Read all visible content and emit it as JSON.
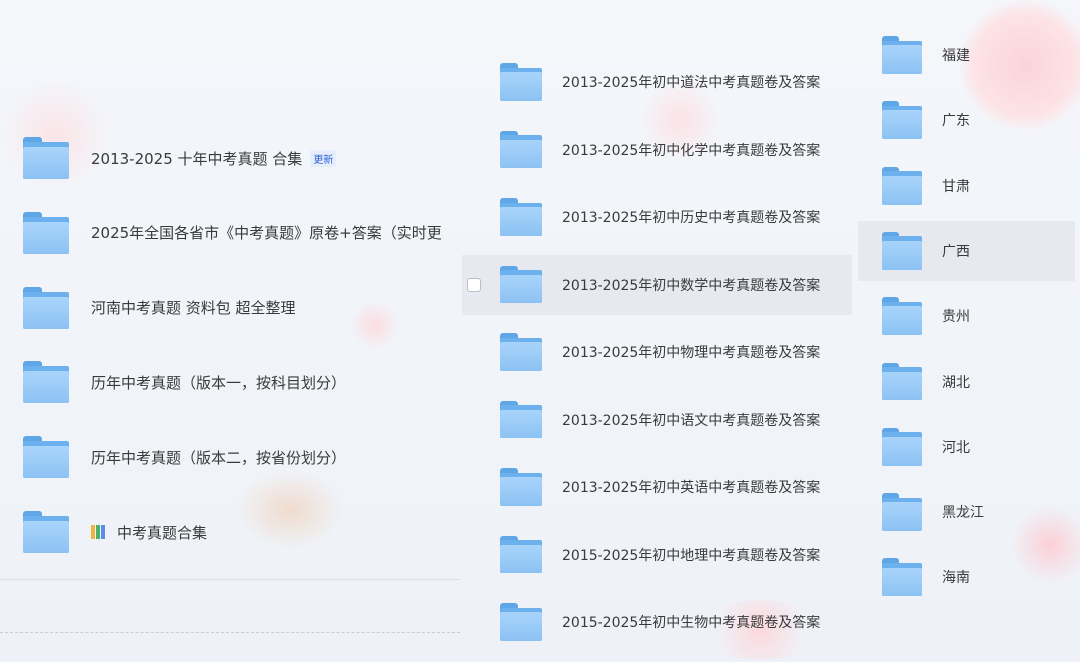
{
  "colors": {
    "folder_front": "#a9d4fb",
    "folder_back": "#6cb1ee",
    "accent": "#2b62d9",
    "selected": "#e6eaf0"
  },
  "left": {
    "items": [
      {
        "label": "2013-2025   十年中考真题  合集",
        "badge": "更新"
      },
      {
        "label": "2025年全国各省市《中考真题》原卷+答案（实时更"
      },
      {
        "label": "河南中考真题 资料包  超全整理"
      },
      {
        "label": "历年中考真题（版本一，按科目划分）"
      },
      {
        "label": "历年中考真题（版本二，按省份划分）"
      },
      {
        "label": "中考真题合集",
        "icon": "books-icon"
      }
    ]
  },
  "middle": {
    "items": [
      {
        "label": "2013-2025年初中道法中考真题卷及答案"
      },
      {
        "label": "2013-2025年初中化学中考真题卷及答案"
      },
      {
        "label": "2013-2025年初中历史中考真题卷及答案"
      },
      {
        "label": "2013-2025年初中数学中考真题卷及答案",
        "selected": true
      },
      {
        "label": "2013-2025年初中物理中考真题卷及答案"
      },
      {
        "label": "2013-2025年初中语文中考真题卷及答案"
      },
      {
        "label": "2013-2025年初中英语中考真题卷及答案"
      },
      {
        "label": "2015-2025年初中地理中考真题卷及答案"
      },
      {
        "label": "2015-2025年初中生物中考真题卷及答案"
      }
    ]
  },
  "right": {
    "items": [
      {
        "label": "福建"
      },
      {
        "label": "广东"
      },
      {
        "label": "甘肃"
      },
      {
        "label": "广西",
        "selected": true
      },
      {
        "label": "贵州"
      },
      {
        "label": "湖北"
      },
      {
        "label": "河北"
      },
      {
        "label": "黑龙江"
      },
      {
        "label": "海南"
      }
    ]
  }
}
